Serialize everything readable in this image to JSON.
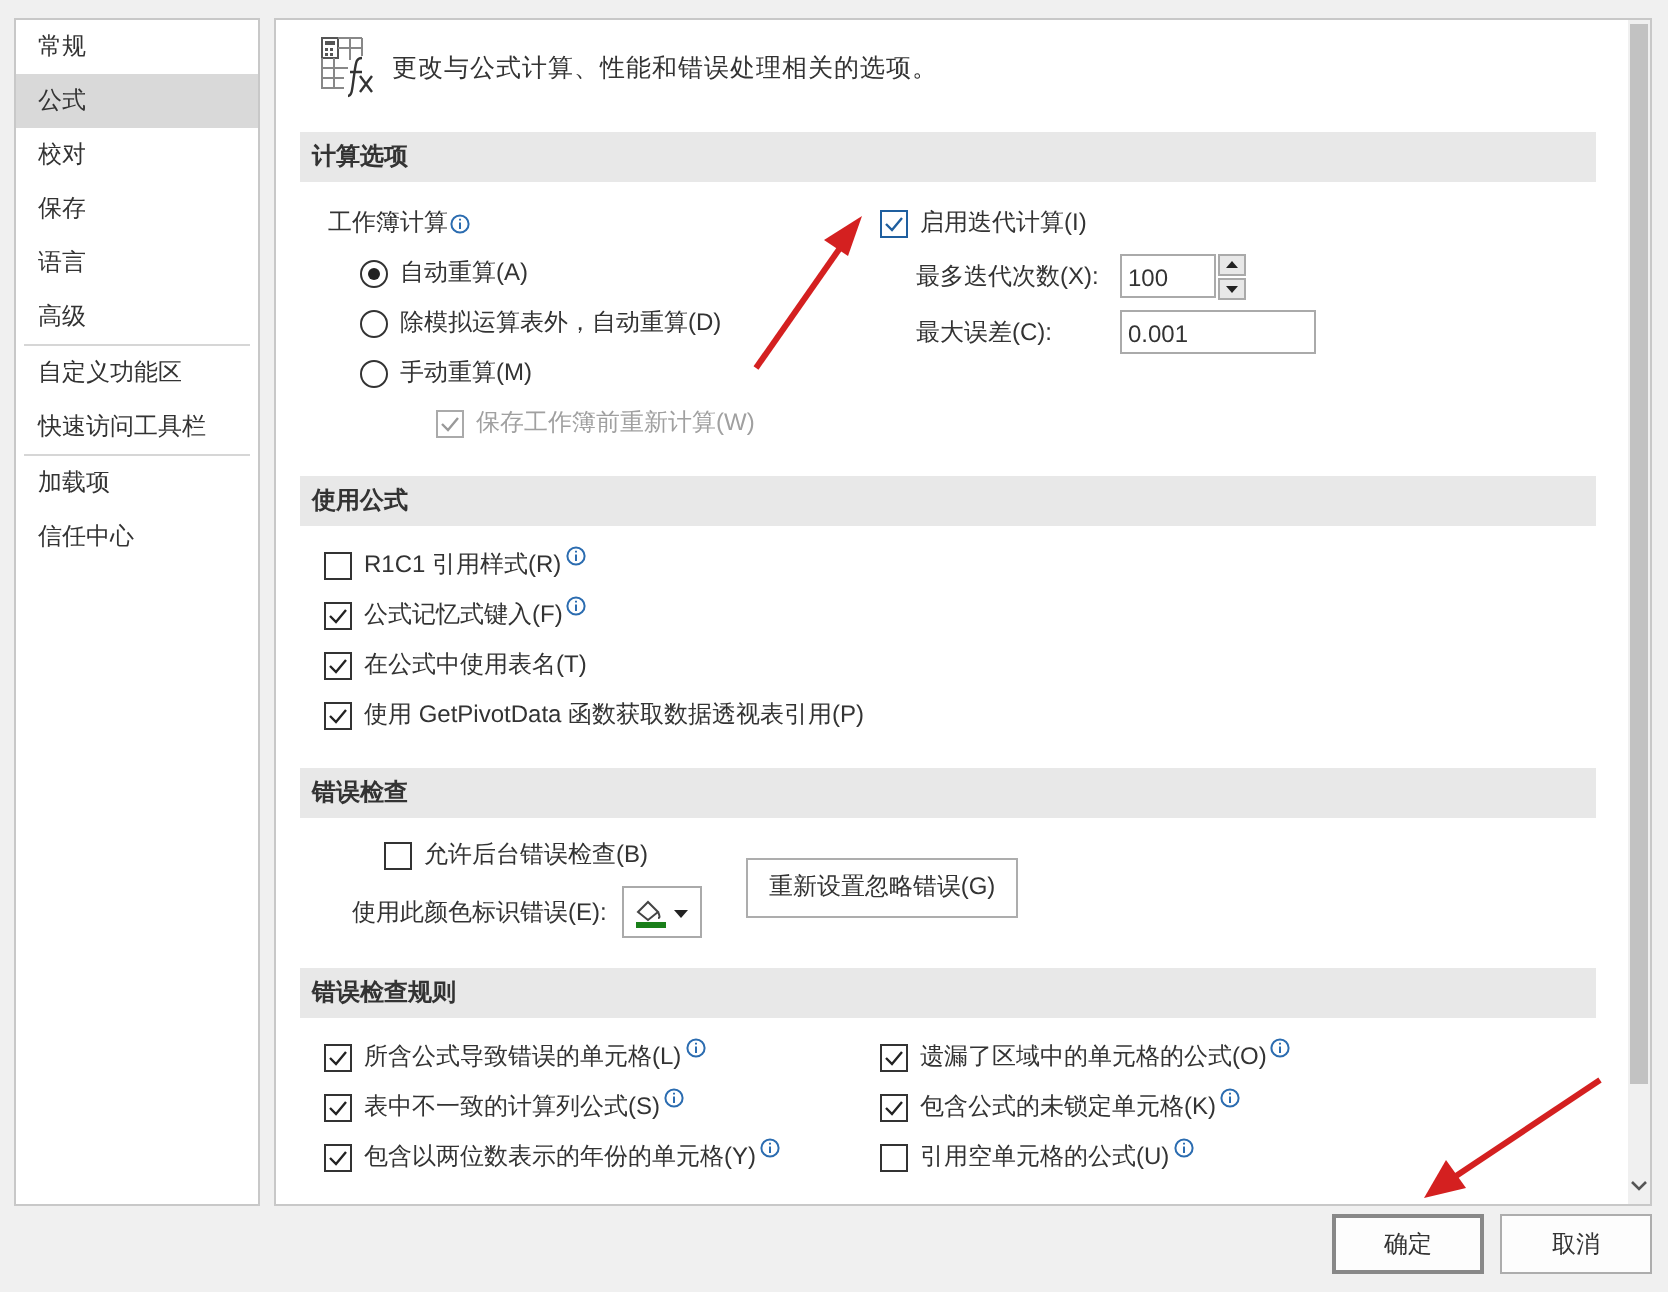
{
  "sidebar": {
    "groups": [
      {
        "items": [
          {
            "label": "常规",
            "selected": false
          },
          {
            "label": "公式",
            "selected": true
          },
          {
            "label": "校对",
            "selected": false
          },
          {
            "label": "保存",
            "selected": false
          },
          {
            "label": "语言",
            "selected": false
          },
          {
            "label": "高级",
            "selected": false
          }
        ]
      },
      {
        "items": [
          {
            "label": "自定义功能区",
            "selected": false
          },
          {
            "label": "快速访问工具栏",
            "selected": false
          }
        ]
      },
      {
        "items": [
          {
            "label": "加载项",
            "selected": false
          },
          {
            "label": "信任中心",
            "selected": false
          }
        ]
      }
    ]
  },
  "header": {
    "description": "更改与公式计算、性能和错误处理相关的选项。"
  },
  "sections": [
    {
      "kind": "calculation",
      "title": "计算选项",
      "workbook_calc": {
        "label": "工作簿计算",
        "options": [
          {
            "label": "自动重算(A)",
            "selected": true
          },
          {
            "label": "除模拟运算表外，自动重算(D)",
            "selected": false
          },
          {
            "label": "手动重算(M)",
            "selected": false
          }
        ]
      },
      "recalc_before_save": {
        "label": "保存工作簿前重新计算(W)",
        "checked": true,
        "disabled": true
      },
      "iterative": {
        "label": "启用迭代计算(I)",
        "checked": true
      },
      "max_iterations": {
        "label": "最多迭代次数(X):",
        "value": "100"
      },
      "max_change": {
        "label": "最大误差(C):",
        "value": "0.001"
      }
    },
    {
      "kind": "checklist",
      "title": "使用公式",
      "columns": [
        [
          {
            "label": "R1C1 引用样式(R)",
            "checked": false,
            "info": true
          },
          {
            "label": "公式记忆式键入(F)",
            "checked": true,
            "info": true
          },
          {
            "label": "在公式中使用表名(T)",
            "checked": true,
            "info": false
          },
          {
            "label": "使用 GetPivotData 函数获取数据透视表引用(P)",
            "checked": true,
            "info": false
          }
        ]
      ]
    },
    {
      "kind": "error_checking",
      "title": "错误检查",
      "background": {
        "label": "允许后台错误检查(B)",
        "checked": false
      },
      "color_label": "使用此颜色标识错误(E):",
      "reset_button": "重新设置忽略错误(G)"
    },
    {
      "kind": "checklist",
      "title": "错误检查规则",
      "columns": [
        [
          {
            "label": "所含公式导致错误的单元格(L)",
            "checked": true,
            "info": true
          },
          {
            "label": "表中不一致的计算列公式(S)",
            "checked": true,
            "info": true
          },
          {
            "label": "包含以两位数表示的年份的单元格(Y)",
            "checked": true,
            "info": true
          }
        ],
        [
          {
            "label": "遗漏了区域中的单元格的公式(O)",
            "checked": true,
            "info": true
          },
          {
            "label": "包含公式的未锁定单元格(K)",
            "checked": true,
            "info": true
          },
          {
            "label": "引用空单元格的公式(U)",
            "checked": false,
            "info": true
          }
        ]
      ]
    }
  ],
  "buttons": [
    {
      "label": "确定",
      "default": true
    },
    {
      "label": "取消",
      "default": false
    }
  ]
}
